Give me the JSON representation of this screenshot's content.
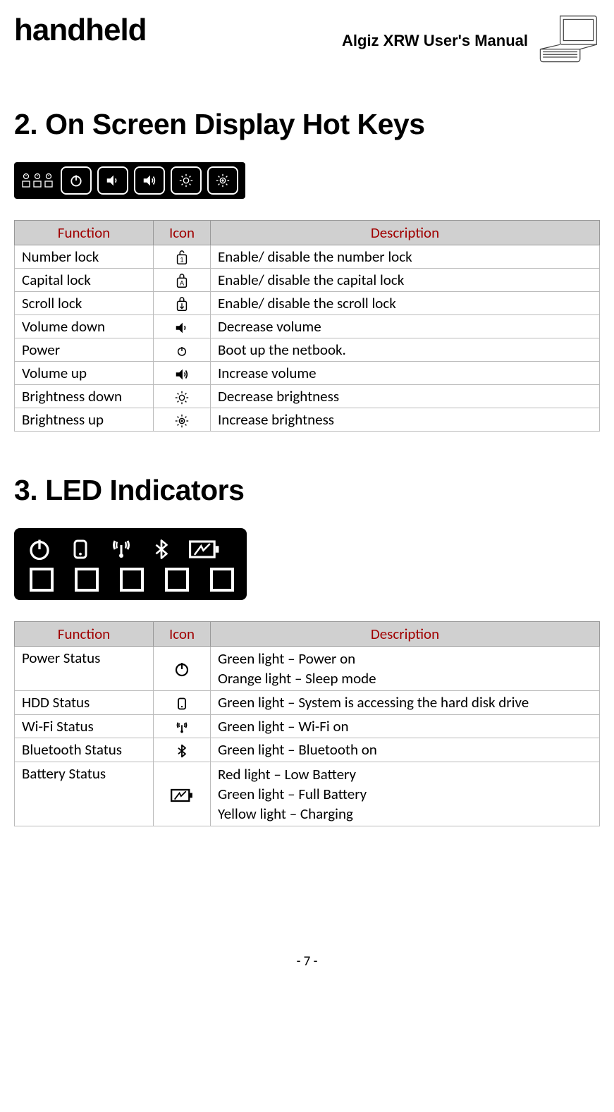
{
  "header": {
    "brand": "handheld",
    "manual_title": "Algiz XRW User's Manual"
  },
  "section2": {
    "title": "2.  On Screen Display Hot Keys",
    "table": {
      "headers": {
        "function": "Function",
        "icon": "Icon",
        "description": "Description"
      },
      "rows": [
        {
          "function": "Number lock",
          "icon": "numlock-icon",
          "description": "Enable/ disable the number lock"
        },
        {
          "function": "Capital lock",
          "icon": "capslock-icon",
          "description": "Enable/ disable the capital lock"
        },
        {
          "function": "Scroll lock",
          "icon": "scrolllock-icon",
          "description": "Enable/ disable the scroll lock"
        },
        {
          "function": "Volume down",
          "icon": "volume-down-icon",
          "description": "Decrease volume"
        },
        {
          "function": "Power",
          "icon": "power-icon",
          "description": "Boot up the netbook."
        },
        {
          "function": "Volume up",
          "icon": "volume-up-icon",
          "description": "Increase volume"
        },
        {
          "function": "Brightness down",
          "icon": "brightness-down-icon",
          "description": "Decrease brightness"
        },
        {
          "function": "Brightness up",
          "icon": "brightness-up-icon",
          "description": "Increase brightness"
        }
      ]
    }
  },
  "section3": {
    "title": "3.  LED Indicators",
    "table": {
      "headers": {
        "function": "Function",
        "icon": "Icon",
        "description": "Description"
      },
      "rows": [
        {
          "function": "Power Status",
          "icon": "power-icon",
          "description_lines": [
            "Green light – Power on",
            "Orange light – Sleep mode"
          ]
        },
        {
          "function": "HDD Status",
          "icon": "hdd-icon",
          "description_lines": [
            "Green light – System is accessing the hard disk drive"
          ]
        },
        {
          "function": "Wi-Fi Status",
          "icon": "wifi-icon",
          "description_lines": [
            "Green light – Wi-Fi on"
          ]
        },
        {
          "function": "Bluetooth Status",
          "icon": "bluetooth-icon",
          "description_lines": [
            "Green light – Bluetooth on"
          ]
        },
        {
          "function": "Battery Status",
          "icon": "battery-icon",
          "description_lines": [
            "Red light – Low Battery",
            "Green light – Full Battery",
            "Yellow light – Charging"
          ]
        }
      ]
    }
  },
  "footer": {
    "page_number": "- 7 -"
  }
}
